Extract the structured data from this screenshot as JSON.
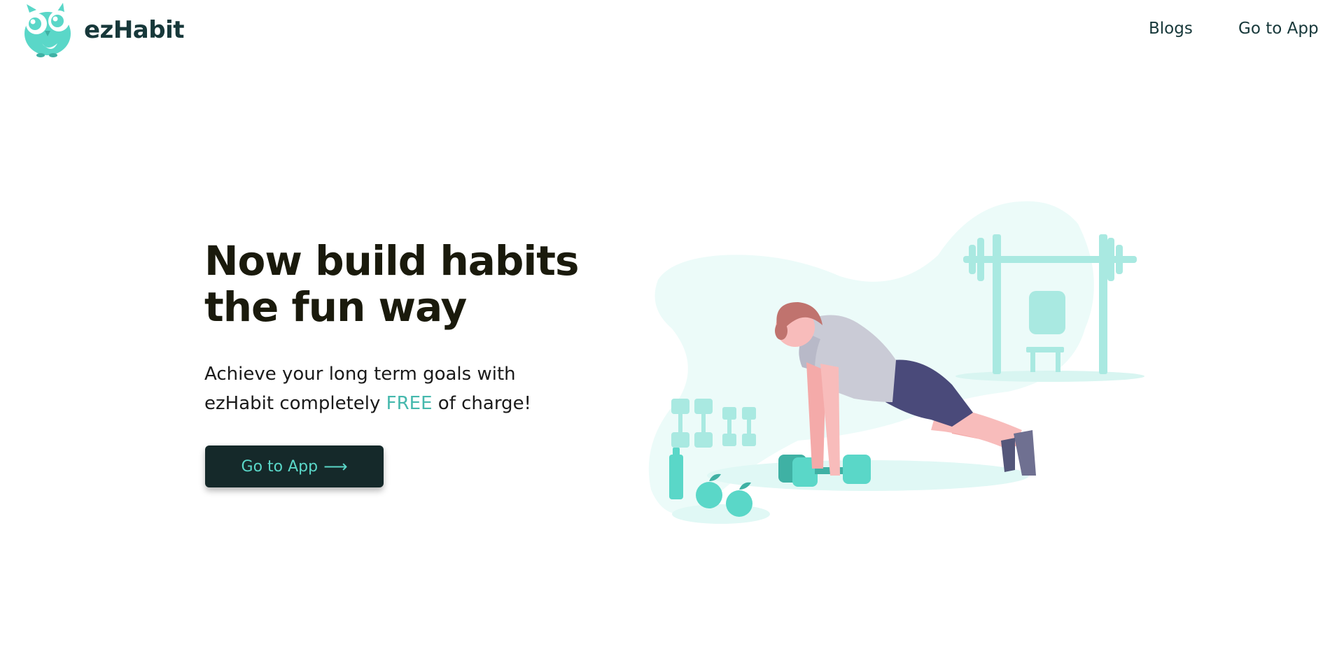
{
  "header": {
    "brand_name": "ezHabit",
    "nav": {
      "blogs_label": "Blogs",
      "app_label": "Go to App"
    }
  },
  "hero": {
    "title_line1": "Now build habits",
    "title_line2": "the fun way",
    "subtitle_part1": "Achieve your long term goals with",
    "subtitle_part2": "ezHabit completely ",
    "subtitle_highlight": "FREE",
    "subtitle_part3": " of charge!",
    "cta_label": "Go to App",
    "cta_arrow": "⟶"
  },
  "colors": {
    "brand_teal": "#5ad7c8",
    "dark_navy": "#15292a",
    "highlight": "#45b8ad",
    "title_text": "#1a1a0c"
  },
  "icons": {
    "logo": "owl-logo-icon",
    "cta_arrow": "arrow-right-icon"
  }
}
